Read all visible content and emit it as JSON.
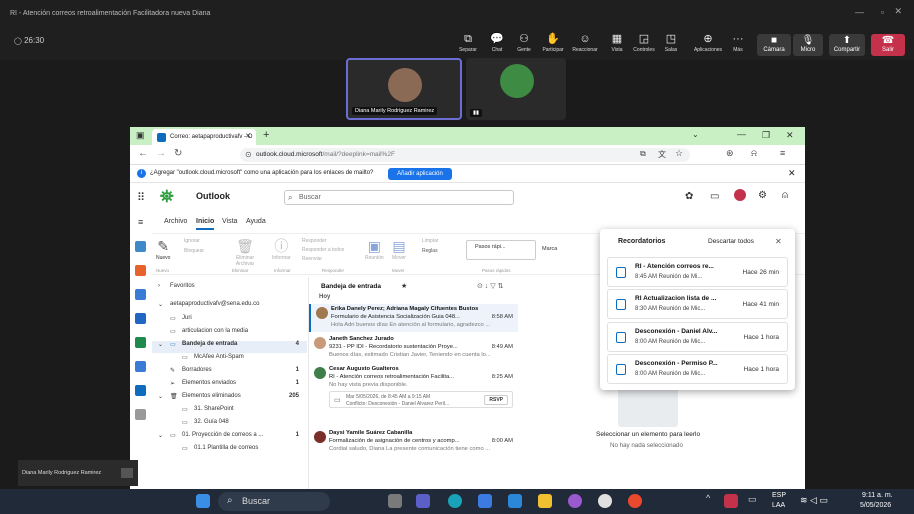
{
  "teams": {
    "window_title": "RI - Atención correos retroalimentación Facilitadora nueva Diana",
    "timer": "26:30",
    "toolbar": [
      "Separar",
      "Chat",
      "Gente",
      "Participar",
      "Reaccionar",
      "Vista",
      "Controles",
      "Salas",
      "Aplicaciones",
      "Más"
    ],
    "camera_label": "Cámara",
    "mic_label": "Micro",
    "share_label": "Compartir",
    "leave_label": "Salir",
    "participant_1": "Diana Marily Rodriguez Ramirez",
    "self_view_name": "Diana Marily Rodriguez Ramirez"
  },
  "browser": {
    "tab_title": "Correo: aetapaproductivafv - O",
    "url_domain": "outlook.cloud.microsoft",
    "url_path": "/mail/?deeplink=mail%2F",
    "infobar_text": "¿Agregar \"outlook.cloud.microsoft\" como una aplicación para los enlaces de mailto?",
    "infobar_button": "Añadir aplicación"
  },
  "outlook": {
    "app_name": "Outlook",
    "search_placeholder": "Buscar",
    "ribbon_tabs": [
      "Archivo",
      "Inicio",
      "Vista",
      "Ayuda"
    ],
    "ribbon": {
      "nuevo": "Nuevo",
      "ignorar": "Ignorar",
      "bloquear": "Bloquear",
      "eliminar_archivar": "Eliminar Archivar",
      "informar": "Informar",
      "responder": "Responder",
      "responder_todos": "Responder a todos",
      "reenviar": "Reenviar",
      "reunion": "Reunión",
      "mover": "Mover",
      "limpiar": "Limpiar",
      "reglas": "Reglas",
      "pasos_rapidos": "Pasos rápi...",
      "marcar": "Marca",
      "groups": [
        "Nuevo",
        "Eliminar",
        "Informar",
        "Responder",
        "Mover",
        "Pasos rápidos"
      ]
    },
    "folders": {
      "favoritos": "Favoritos",
      "account": "aetapaproductivafv@sena.edu.co",
      "items": [
        {
          "label": "Juri",
          "count": ""
        },
        {
          "label": "articulacion con la media",
          "count": ""
        },
        {
          "label": "Bandeja de entrada",
          "count": "4"
        },
        {
          "label": "McAfee Anti-Spam",
          "count": ""
        },
        {
          "label": "Borradores",
          "count": "1"
        },
        {
          "label": "Elementos enviados",
          "count": "1"
        },
        {
          "label": "Elementos eliminados",
          "count": "205"
        },
        {
          "label": "31. SharePoint",
          "count": ""
        },
        {
          "label": "32. Guía 048",
          "count": ""
        },
        {
          "label": "01. Proyección de correos a ...",
          "count": "1"
        },
        {
          "label": "01.1 Plantilla de correos",
          "count": ""
        }
      ]
    },
    "message_list": {
      "header": "Bandeja de entrada",
      "group": "Hoy",
      "messages": [
        {
          "name": "Erika Danely Perez; Adriana Magaly Cifuentes Bustos",
          "subject": "Formulario de Asistencia Socialización Guia 048...",
          "time": "8:58 AM",
          "preview": "Hola Adri buenos días En atención al formulario, agradezco ..."
        },
        {
          "name": "Janeth Sanchez Jurado",
          "subject": "9231 - PP IDI - Recordatorio sustentación Proye...",
          "time": "8:49 AM",
          "preview": "Buenos días, estimado Cristian Javier, Teniendo en cuenta lo..."
        },
        {
          "name": "Cesar Augusto Gualteros",
          "subject": "RI - Atención correos retroalimentación Facilita...",
          "time": "8:25 AM",
          "preview": "No hay vista previa disponible."
        },
        {
          "name": "Daysi Yamile Suárez Cabanilla",
          "subject": "Formalización de asignación de centros y acomp...",
          "time": "8:00 AM",
          "preview": "Cordial saludo, Diana La presente comunicación tiene como ..."
        }
      ],
      "meeting_line1": "Mar 5/05/2026, de 8:45 AM a 9:15 AM",
      "meeting_line2": "Conflicto: Desconexión - Daniel Alvarez Peril...",
      "rsvp": "RSVP"
    },
    "reading": {
      "title": "Seleccionar un elemento para leerlo",
      "subtitle": "No hay nada seleccionado"
    },
    "reminders": {
      "title": "Recordatorios",
      "dismiss_all": "Descartar todos",
      "items": [
        {
          "title": "RI - Atención correos re...",
          "sub": "8:45 AM Reunión de Mi...",
          "ago": "Hace 26 min"
        },
        {
          "title": "RI Actualizacion lista de ...",
          "sub": "8:30 AM Reunión de Mic...",
          "ago": "Hace 41 min"
        },
        {
          "title": "Desconexión - Daniel Alv...",
          "sub": "8:00 AM Reunión de Mic...",
          "ago": "Hace 1 hora"
        },
        {
          "title": "Desconexión - Permiso P...",
          "sub": "8:00 AM Reunión de Mic...",
          "ago": "Hace 1 hora"
        }
      ]
    }
  },
  "taskbar": {
    "search": "Buscar",
    "lang1": "ESP",
    "lang2": "LAA",
    "time": "9:11 a. m.",
    "date": "5/05/2026"
  },
  "colors": {
    "accent": "#0f6cbd",
    "browser_tab": "#c8f0c4",
    "taskbar": "#202a38"
  }
}
